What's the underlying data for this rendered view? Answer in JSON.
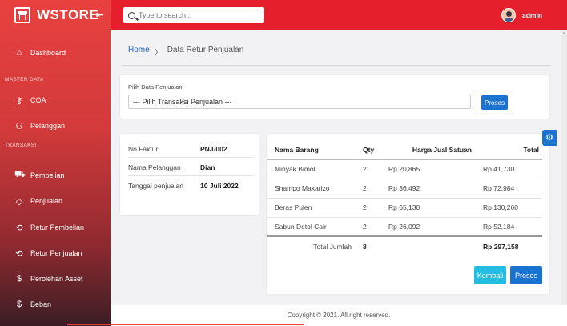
{
  "brand": {
    "name": "WSTORE"
  },
  "topbar": {
    "search_placeholder": "Type to search...",
    "user": "admin"
  },
  "sidebar": {
    "items": [
      {
        "label": "Dashboard",
        "icon": "home-icon"
      },
      {
        "section": "MASTER DATA"
      },
      {
        "label": "COA",
        "icon": "key-icon"
      },
      {
        "label": "Pelanggan",
        "icon": "user-add-icon"
      },
      {
        "section": "TRANSAKSI"
      },
      {
        "label": "Pembelian",
        "icon": "cart-icon"
      },
      {
        "label": "Penjualan",
        "icon": "tag-icon"
      },
      {
        "label": "Retur Pembelian",
        "icon": "return-icon"
      },
      {
        "label": "Retur Penjualan",
        "icon": "return-icon"
      },
      {
        "label": "Perolehan Asset",
        "icon": "money-icon"
      },
      {
        "label": "Beban",
        "icon": "money-icon"
      }
    ]
  },
  "breadcrumb": {
    "home": "Home",
    "separator": "〉",
    "current": "Data Retur Penjualan"
  },
  "selector": {
    "label": "Pilih Data Penjualan",
    "value": "--- Pilih Transaksi Penjualan ---",
    "button": "Proses"
  },
  "info": {
    "rows": [
      {
        "label": "No Faktur",
        "value": "PNJ-002"
      },
      {
        "label": "Nama Pelanggan",
        "value": "Dian"
      },
      {
        "label": "Tanggal penjualan",
        "value": "10 Juli 2022"
      }
    ]
  },
  "items_table": {
    "headers": [
      "Nama Barang",
      "Qty",
      "Harga Jual Satuan",
      "Total"
    ],
    "rows": [
      [
        "Minyak Bimoli",
        "2",
        "Rp 20,865",
        "Rp 41,730"
      ],
      [
        "Shampo Makarizo",
        "2",
        "Rp 36,492",
        "Rp 72,984"
      ],
      [
        "Beras Pulen",
        "2",
        "Rp 65,130",
        "Rp 130,260"
      ],
      [
        "Sabun Detol Cair",
        "2",
        "Rp 26,092",
        "Rp 52,184"
      ]
    ],
    "total": {
      "label": "Total Jumlah",
      "qty": "8",
      "value": "Rp 297,158"
    }
  },
  "actions": {
    "back": "Kembali",
    "process": "Proses"
  },
  "footer": "Copyright © 2021. All right reserved.",
  "colors": {
    "topbar": "#e61f2c",
    "primary": "#1b73d1",
    "info": "#22bde0"
  }
}
